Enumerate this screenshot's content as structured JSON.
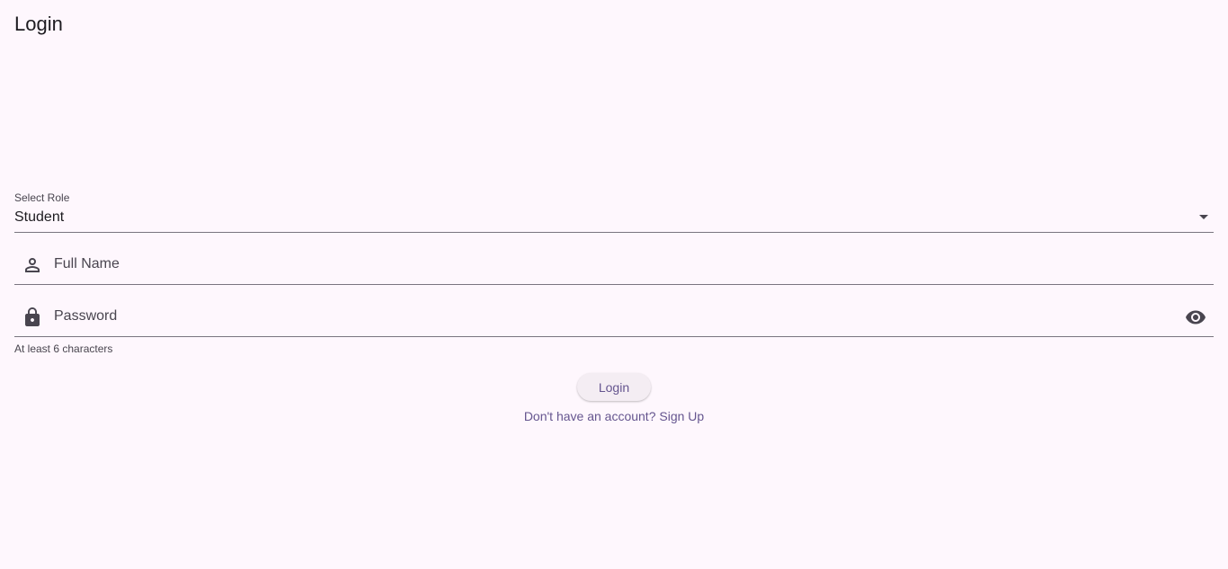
{
  "app_bar": {
    "title": "Login"
  },
  "role_select": {
    "label": "Select Role",
    "value": "Student"
  },
  "full_name": {
    "placeholder": "Full Name",
    "icon": "person-outline-icon"
  },
  "password": {
    "placeholder": "Password",
    "icon": "lock-icon",
    "visibility_icon": "eye-icon",
    "helper": "At least 6 characters"
  },
  "actions": {
    "login_label": "Login",
    "signup_prompt": "Don't have an account? Sign Up"
  },
  "colors": {
    "background": "#fef7fd",
    "accent": "#65558f",
    "text": "#1d1b20",
    "muted": "#49454f",
    "underline": "#7a7580"
  }
}
